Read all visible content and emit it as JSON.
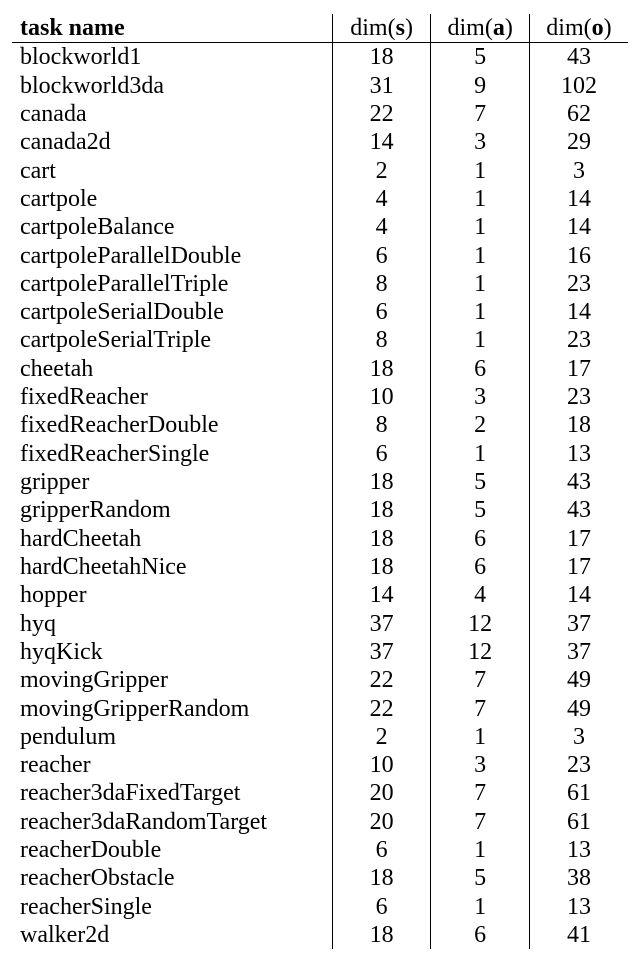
{
  "headers": {
    "name_bold": "task name",
    "dim_s": "dim(s)",
    "dim_a": "dim(a)",
    "dim_o": "dim(o)"
  },
  "chart_data": {
    "type": "table",
    "columns": [
      "task name",
      "dim(s)",
      "dim(a)",
      "dim(o)"
    ],
    "rows": [
      {
        "name": "blockworld1",
        "s": 18,
        "a": 5,
        "o": 43
      },
      {
        "name": "blockworld3da",
        "s": 31,
        "a": 9,
        "o": 102
      },
      {
        "name": "canada",
        "s": 22,
        "a": 7,
        "o": 62
      },
      {
        "name": "canada2d",
        "s": 14,
        "a": 3,
        "o": 29
      },
      {
        "name": "cart",
        "s": 2,
        "a": 1,
        "o": 3
      },
      {
        "name": "cartpole",
        "s": 4,
        "a": 1,
        "o": 14
      },
      {
        "name": "cartpoleBalance",
        "s": 4,
        "a": 1,
        "o": 14
      },
      {
        "name": "cartpoleParallelDouble",
        "s": 6,
        "a": 1,
        "o": 16
      },
      {
        "name": "cartpoleParallelTriple",
        "s": 8,
        "a": 1,
        "o": 23
      },
      {
        "name": "cartpoleSerialDouble",
        "s": 6,
        "a": 1,
        "o": 14
      },
      {
        "name": "cartpoleSerialTriple",
        "s": 8,
        "a": 1,
        "o": 23
      },
      {
        "name": "cheetah",
        "s": 18,
        "a": 6,
        "o": 17
      },
      {
        "name": "fixedReacher",
        "s": 10,
        "a": 3,
        "o": 23
      },
      {
        "name": "fixedReacherDouble",
        "s": 8,
        "a": 2,
        "o": 18
      },
      {
        "name": "fixedReacherSingle",
        "s": 6,
        "a": 1,
        "o": 13
      },
      {
        "name": "gripper",
        "s": 18,
        "a": 5,
        "o": 43
      },
      {
        "name": "gripperRandom",
        "s": 18,
        "a": 5,
        "o": 43
      },
      {
        "name": "hardCheetah",
        "s": 18,
        "a": 6,
        "o": 17
      },
      {
        "name": "hardCheetahNice",
        "s": 18,
        "a": 6,
        "o": 17
      },
      {
        "name": "hopper",
        "s": 14,
        "a": 4,
        "o": 14
      },
      {
        "name": "hyq",
        "s": 37,
        "a": 12,
        "o": 37
      },
      {
        "name": "hyqKick",
        "s": 37,
        "a": 12,
        "o": 37
      },
      {
        "name": "movingGripper",
        "s": 22,
        "a": 7,
        "o": 49
      },
      {
        "name": "movingGripperRandom",
        "s": 22,
        "a": 7,
        "o": 49
      },
      {
        "name": "pendulum",
        "s": 2,
        "a": 1,
        "o": 3
      },
      {
        "name": "reacher",
        "s": 10,
        "a": 3,
        "o": 23
      },
      {
        "name": "reacher3daFixedTarget",
        "s": 20,
        "a": 7,
        "o": 61
      },
      {
        "name": "reacher3daRandomTarget",
        "s": 20,
        "a": 7,
        "o": 61
      },
      {
        "name": "reacherDouble",
        "s": 6,
        "a": 1,
        "o": 13
      },
      {
        "name": "reacherObstacle",
        "s": 18,
        "a": 5,
        "o": 38
      },
      {
        "name": "reacherSingle",
        "s": 6,
        "a": 1,
        "o": 13
      },
      {
        "name": "walker2d",
        "s": 18,
        "a": 6,
        "o": 41
      }
    ]
  }
}
